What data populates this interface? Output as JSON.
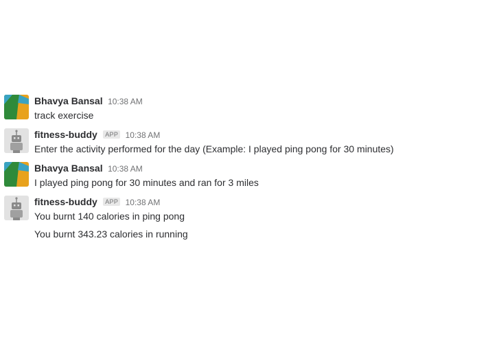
{
  "messages": [
    {
      "author": "Bhavya Bansal",
      "avatar_icon": "user-avatar-icon",
      "time": "10:38 AM",
      "lines": [
        "track exercise"
      ]
    },
    {
      "author": "fitness-buddy",
      "badge": "APP",
      "avatar_icon": "robot-avatar-icon",
      "time": "10:38 AM",
      "lines": [
        "Enter the activity performed for the day (Example: I played ping pong for 30 minutes)"
      ]
    },
    {
      "author": "Bhavya Bansal",
      "avatar_icon": "user-avatar-icon",
      "time": "10:38 AM",
      "lines": [
        "I played ping pong for 30 minutes and ran for 3 miles"
      ]
    },
    {
      "author": "fitness-buddy",
      "badge": "APP",
      "avatar_icon": "robot-avatar-icon",
      "time": "10:38 AM",
      "lines": [
        "You burnt 140 calories in ping pong",
        "You burnt 343.23 calories in running"
      ]
    }
  ],
  "colors": {
    "user_avatar_green": "#2f8a3a",
    "user_avatar_orange": "#e8a21d",
    "user_avatar_teal": "#3aa3c2",
    "bot_avatar_bg": "#e2e2e2",
    "bot_avatar_fg": "#8a8a8a",
    "timestamp": "#717274"
  }
}
